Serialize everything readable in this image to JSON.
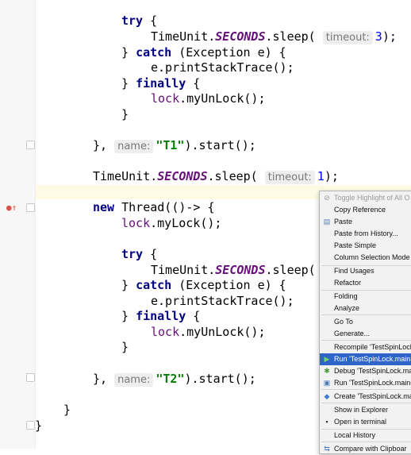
{
  "code": {
    "try1": "try",
    "timeunit": "TimeUnit.",
    "seconds": "SECONDS",
    "sleep_call": ".sleep(",
    "hint_timeout": "timeout:",
    "val3": "3",
    "close_stmt": ");",
    "catch_close": "} ",
    "catch_kw": "catch",
    "catch_rest": " (Exception e) {",
    "print_trace": "e.printStackTrace();",
    "finally_close": "} ",
    "finally_kw": "finally",
    "brace_open": " {",
    "unlock": "lock.myUnLock();",
    "brace_close": "}",
    "thread_end_prefix": "},",
    "hint_name": "name:",
    "t1": "\"T1\"",
    "start_suffix": ").start();",
    "val1": "1",
    "new_kw": "new",
    "thread_open": " Thread(()-> {",
    "mylock": "lock.myLock();",
    "t2": "\"T2\"",
    "try_open": " {",
    "sleep_partial": ".sleep("
  },
  "menu": {
    "items": [
      {
        "label": "Toggle Highlight of All O",
        "disabled": true
      },
      {
        "label": "Copy Reference"
      },
      {
        "label": "Paste",
        "icon": "paste-icon"
      },
      {
        "label": "Paste from History..."
      },
      {
        "label": "Paste Simple"
      },
      {
        "label": "Column Selection Mode"
      },
      {
        "label": "Find Usages"
      },
      {
        "label": "Refactor"
      },
      {
        "label": "Folding"
      },
      {
        "label": "Analyze"
      },
      {
        "label": "Go To"
      },
      {
        "label": "Generate..."
      },
      {
        "label": "Recompile 'TestSpinLock"
      },
      {
        "label": "Run 'TestSpinLock.main",
        "selected": true,
        "icon": "run-icon"
      },
      {
        "label": "Debug 'TestSpinLock.ma",
        "icon": "debug-icon"
      },
      {
        "label": "Run 'TestSpinLock.main(",
        "icon": "coverage-icon"
      },
      {
        "label": "Create 'TestSpinLock.ma",
        "icon": "create-config-icon"
      },
      {
        "label": "Show in Explorer"
      },
      {
        "label": "Open in terminal",
        "icon": "terminal-icon"
      },
      {
        "label": "Local History"
      },
      {
        "label": "Compare with Clipboar",
        "icon": "compare-icon"
      }
    ]
  },
  "colors": {
    "keyword": "#000080",
    "static_field": "#660e7a",
    "string": "#008000",
    "number": "#0000ff",
    "menu_selected": "#2f65ca"
  }
}
